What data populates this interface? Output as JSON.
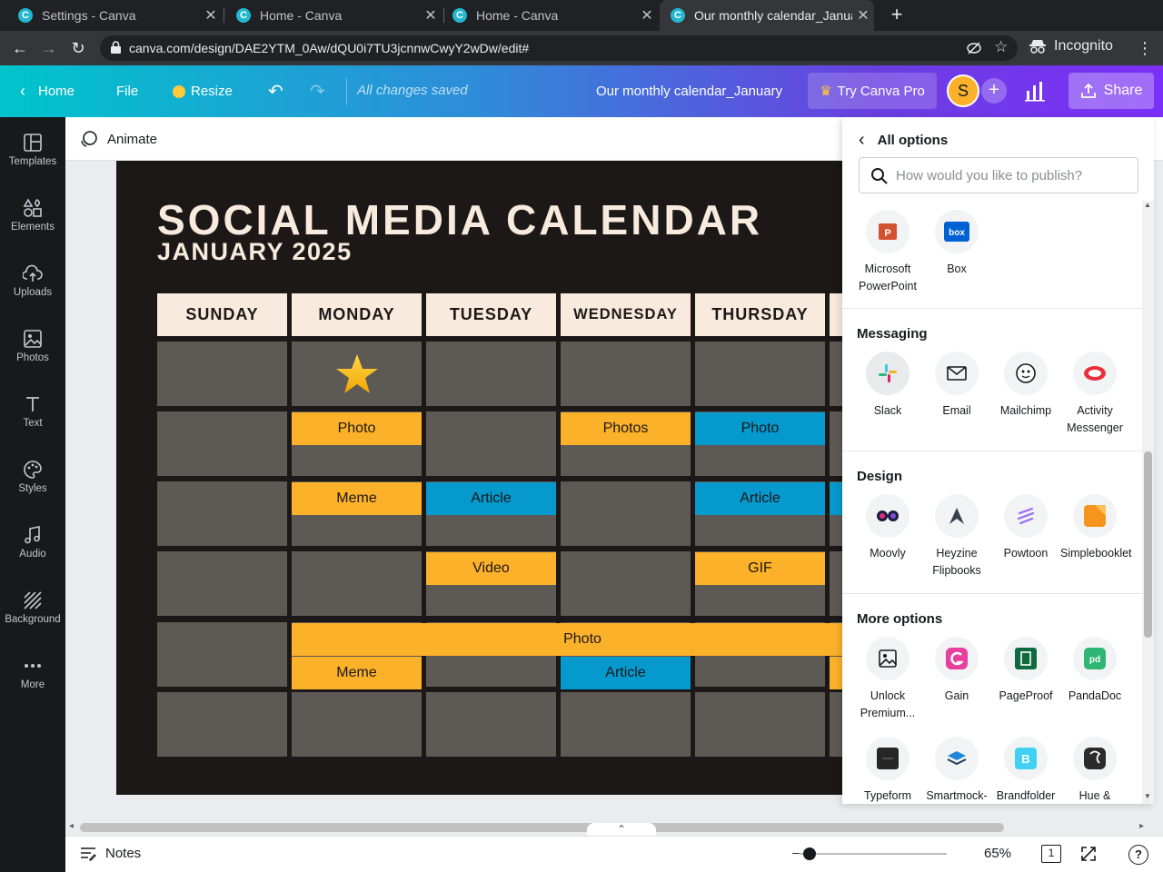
{
  "browser": {
    "tabs": [
      {
        "title": "Settings - Canva"
      },
      {
        "title": "Home - Canva"
      },
      {
        "title": "Home - Canva"
      },
      {
        "title": "Our monthly calendar_January"
      }
    ],
    "url": "canva.com/design/DAE2YTM_0Aw/dQU0i7TU3jcnnwCwyY2wDw/edit#",
    "mode": "Incognito"
  },
  "header": {
    "home": "Home",
    "file": "File",
    "resize": "Resize",
    "saved_status": "All changes saved",
    "doc_title": "Our monthly calendar_January",
    "try_pro": "Try Canva Pro",
    "avatar_letter": "S",
    "share": "Share"
  },
  "sidebar": {
    "items": [
      {
        "label": "Templates",
        "icon": "templates-icon"
      },
      {
        "label": "Elements",
        "icon": "elements-icon"
      },
      {
        "label": "Uploads",
        "icon": "uploads-icon"
      },
      {
        "label": "Photos",
        "icon": "photos-icon"
      },
      {
        "label": "Text",
        "icon": "text-icon"
      },
      {
        "label": "Styles",
        "icon": "styles-icon"
      },
      {
        "label": "Audio",
        "icon": "audio-icon"
      },
      {
        "label": "Background",
        "icon": "background-icon"
      },
      {
        "label": "More",
        "icon": "more-icon"
      }
    ]
  },
  "toolbar": {
    "animate": "Animate"
  },
  "calendar": {
    "title": "SOCIAL MEDIA CALENDAR",
    "subtitle": "JANUARY 2025",
    "days": [
      "SUNDAY",
      "MONDAY",
      "TUESDAY",
      "WEDNESDAY",
      "THURSDAY"
    ],
    "tags": {
      "r2_mon": "Photo",
      "r2_wed": "Photos",
      "r2_thu": "Photo",
      "r3_mon": "Meme",
      "r3_tue": "Article",
      "r3_thu": "Article",
      "r4_tue": "Video",
      "r4_thu": "GIF",
      "r5_span": "Photo",
      "r5_mon": "Meme",
      "r5_wed": "Article"
    },
    "colors": {
      "background": "#1c1818",
      "header": "#f8ebdd",
      "cell": "#5d5955",
      "yellow": "#fbb12a",
      "blue": "#0599cd"
    }
  },
  "footer": {
    "notes": "Notes",
    "zoom": "65%",
    "page_count": "1"
  },
  "publish_panel": {
    "back_title": "All options",
    "search_placeholder": "How would you like to publish?",
    "top_apps": [
      {
        "label": "Microsoft PowerPoint",
        "icon": "powerpoint-icon"
      },
      {
        "label": "Box",
        "icon": "box-icon"
      }
    ],
    "sections": [
      {
        "title": "Messaging",
        "apps": [
          {
            "label": "Slack",
            "icon": "slack-icon"
          },
          {
            "label": "Email",
            "icon": "email-icon"
          },
          {
            "label": "Mailchimp",
            "icon": "mailchimp-icon"
          },
          {
            "label": "Activity Messenger",
            "icon": "activity-messenger-icon"
          }
        ]
      },
      {
        "title": "Design",
        "apps": [
          {
            "label": "Moovly",
            "icon": "moovly-icon"
          },
          {
            "label": "Heyzine Flipbooks",
            "icon": "heyzine-icon"
          },
          {
            "label": "Powtoon",
            "icon": "powtoon-icon"
          },
          {
            "label": "Simplebooklet",
            "icon": "simplebooklet-icon"
          }
        ]
      },
      {
        "title": "More options",
        "apps": [
          {
            "label": "Unlock Premium...",
            "icon": "unlock-premium-icon"
          },
          {
            "label": "Gain",
            "icon": "gain-icon"
          },
          {
            "label": "PageProof",
            "icon": "pageproof-icon"
          },
          {
            "label": "PandaDoc",
            "icon": "pandadoc-icon"
          },
          {
            "label": "Typeform",
            "icon": "typeform-icon"
          },
          {
            "label": "Smartmock-",
            "icon": "smartmockups-icon"
          },
          {
            "label": "Brandfolder",
            "icon": "brandfolder-icon"
          },
          {
            "label": "Hue &",
            "icon": "hue-icon"
          }
        ]
      }
    ]
  }
}
